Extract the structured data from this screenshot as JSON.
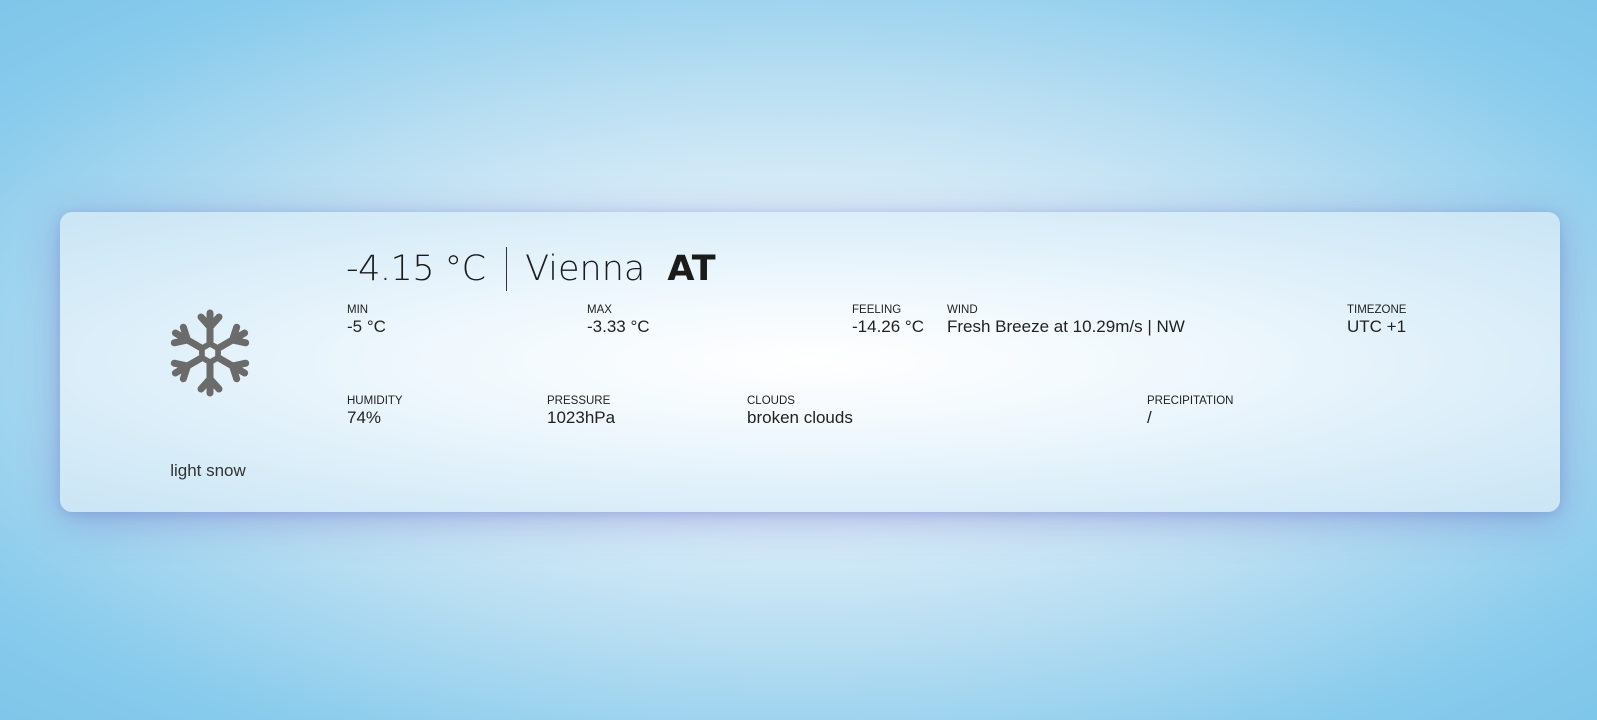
{
  "weather": {
    "icon": "snowflake-icon",
    "condition": "light snow",
    "temperature": "-4.15 °C",
    "city": "Vienna",
    "country": "AT"
  },
  "stats_row1": {
    "min": {
      "label": "MIN",
      "value": "-5 °C"
    },
    "max": {
      "label": "MAX",
      "value": "-3.33 °C"
    },
    "feeling": {
      "label": "FEELING",
      "value": "-14.26 °C"
    },
    "wind": {
      "label": "WIND",
      "value": "Fresh Breeze at 10.29m/s | NW"
    },
    "timezone": {
      "label": "TIMEZONE",
      "value": "UTC +1"
    }
  },
  "stats_row2": {
    "humidity": {
      "label": "HUMIDITY",
      "value": "74%"
    },
    "pressure": {
      "label": "PRESSURE",
      "value": "1023hPa"
    },
    "clouds": {
      "label": "CLOUDS",
      "value": "broken clouds"
    },
    "precipitation": {
      "label": "PRECIPITATION",
      "value": "/"
    }
  },
  "colors": {
    "icon": "#6b6b6b",
    "background_edge": "#7ec6ea",
    "background_center": "#ffffff"
  }
}
